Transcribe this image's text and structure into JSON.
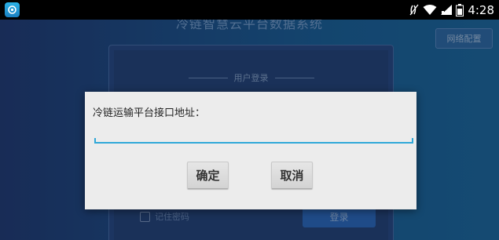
{
  "status_bar": {
    "time": "4:28",
    "app_icon": "app-launcher-icon",
    "icons": [
      "nfc-icon",
      "wifi-icon",
      "signal-icon",
      "battery-icon"
    ]
  },
  "background_app": {
    "title": "冷链智慧云平台数据系统",
    "net_config_label": "网络配置",
    "login_title": "用户登录",
    "remember_label": "记住密码",
    "login_button": "登录"
  },
  "dialog": {
    "label": "冷链运输平台接口地址：",
    "input_value": "",
    "ok_label": "确定",
    "cancel_label": "取消"
  },
  "colors": {
    "accent": "#30a8d8",
    "status_bar": "#000000",
    "dialog_bg": "#ececec",
    "app_bg": "#205594"
  }
}
